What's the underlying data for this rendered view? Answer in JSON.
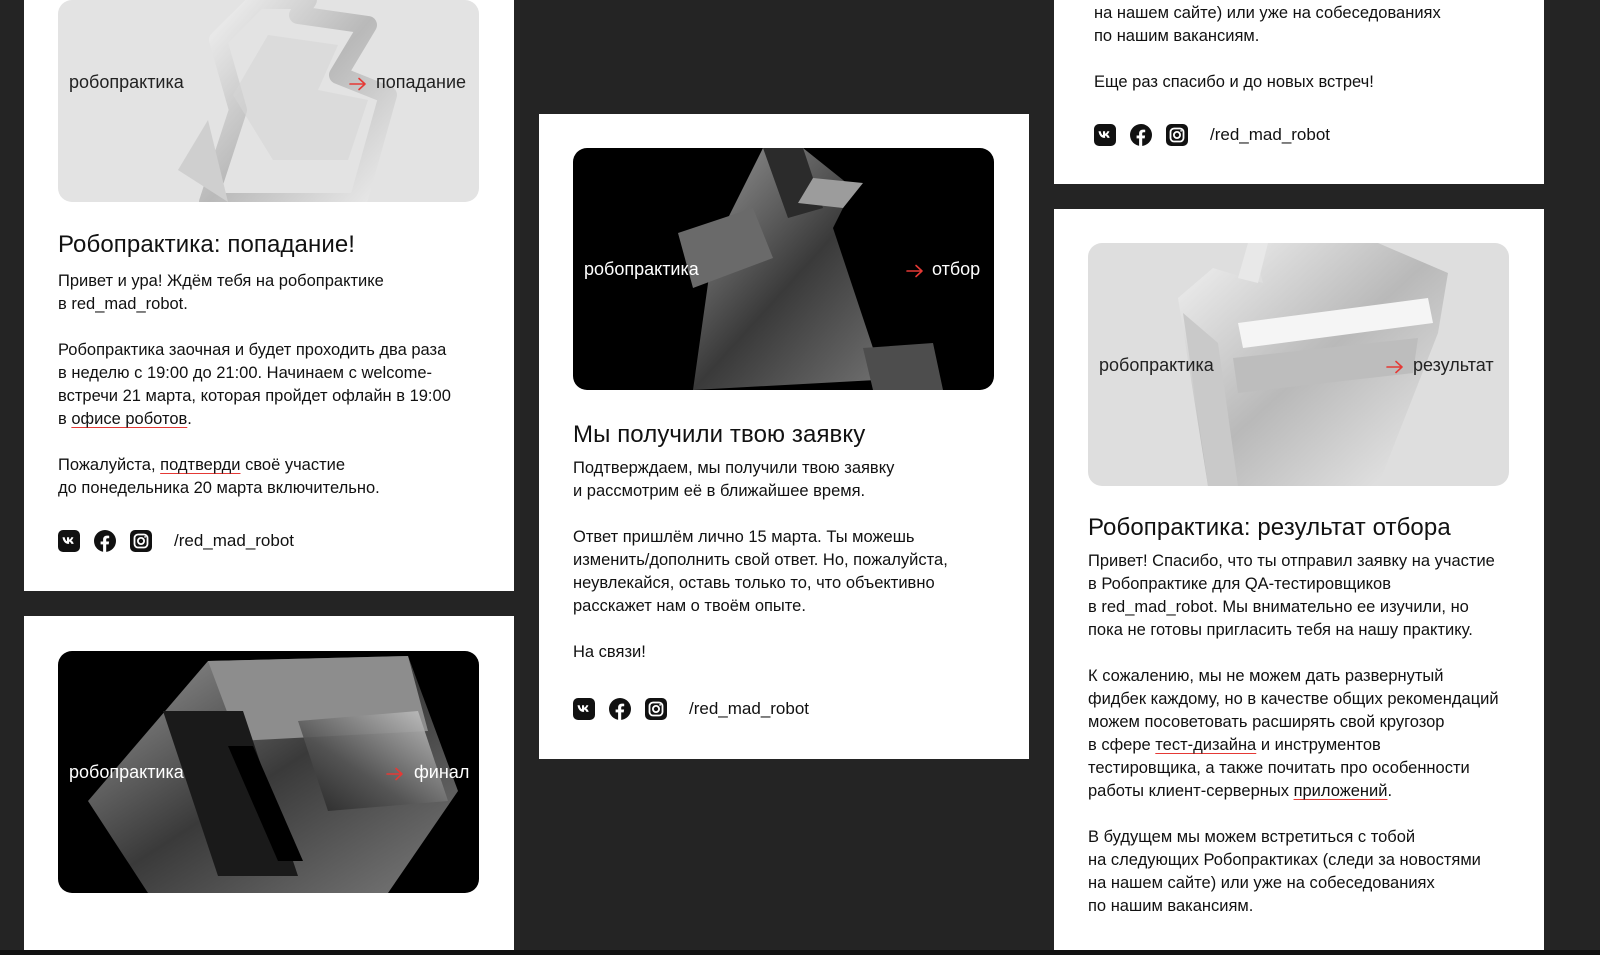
{
  "common": {
    "brand": "робопрактика",
    "handle": "/red_mad_robot",
    "accent": "#e53935"
  },
  "card1": {
    "banner": {
      "tag": "попадание"
    },
    "title": "Робопрактика: попадание!",
    "p1a": "Привет и ура! Ждём тебя на робопрактике",
    "p1b": "в red_mad_robot.",
    "p2a": "Робопрактика заочная и будет проходить два раза",
    "p2b": "в неделю с 19:00 до 21:00. Начинаем с welcome-",
    "p2c": "встречи 21 марта, которая пройдет офлайн в 19:00",
    "p2d_pre": "в ",
    "p2d_link": "офисе роботов",
    "p2d_post": ".",
    "p3a_pre": "Пожалуйста, ",
    "p3a_link": "подтверди",
    "p3a_post": " своё участие",
    "p3b": "до понедельника 20 марта включительно."
  },
  "card2": {
    "banner": {
      "tag": "финал"
    }
  },
  "card3": {
    "banner": {
      "tag": "отбор"
    },
    "title": "Мы получили твою заявку",
    "p1a": "Подтверждаем, мы получили твою заявку",
    "p1b": "и рассмотрим её в ближайшее время.",
    "p2a": "Ответ пришлём лично 15 марта. Ты можешь",
    "p2b": "изменить/дополнить свой ответ. Но, пожалуйста,",
    "p2c": "неувлекайся, оставь только то, что объективно",
    "p2d": "расскажет нам о твоём опыте.",
    "p3": "На связи!"
  },
  "card4": {
    "l1": "на нашем сайте) или уже на собеседованиях",
    "l2": "по нашим вакансиям.",
    "l3": "Еще раз спасибо и до новых встреч!"
  },
  "card5": {
    "banner": {
      "tag": "результат"
    },
    "title": "Робопрактика: результат отбора",
    "p1a": "Привет! Спасибо, что ты отправил заявку на участие",
    "p1b": "в Робопрактике для QA-тестировщиков",
    "p1c": "в red_mad_robot. Мы внимательно ее изучили, но",
    "p1d": "пока не готовы пригласить тебя на нашу практику.",
    "p2a": "К сожалению, мы не можем дать развернутый",
    "p2b": "фидбек каждому, но в качестве общих рекомендаций",
    "p2c": "можем посоветовать расширять свой  кругозор",
    "p2d_pre": "в сфере ",
    "p2d_link": "тест-дизайна",
    "p2d_post": " и инструментов",
    "p2e": "тестировщика, а также почитать про особенности",
    "p2f_pre": "работы клиент-серверных ",
    "p2f_link": "приложений",
    "p2f_post": ".",
    "p3a": "В будущем мы можем встретиться с тобой",
    "p3b": "на следующих Робопрактиках (следи за новостями",
    "p3c": "на нашем сайте) или уже на собеседованиях",
    "p3d": "по нашим вакансиям."
  },
  "icons": [
    "vk-icon",
    "facebook-icon",
    "instagram-icon",
    "arrow-right-icon"
  ]
}
